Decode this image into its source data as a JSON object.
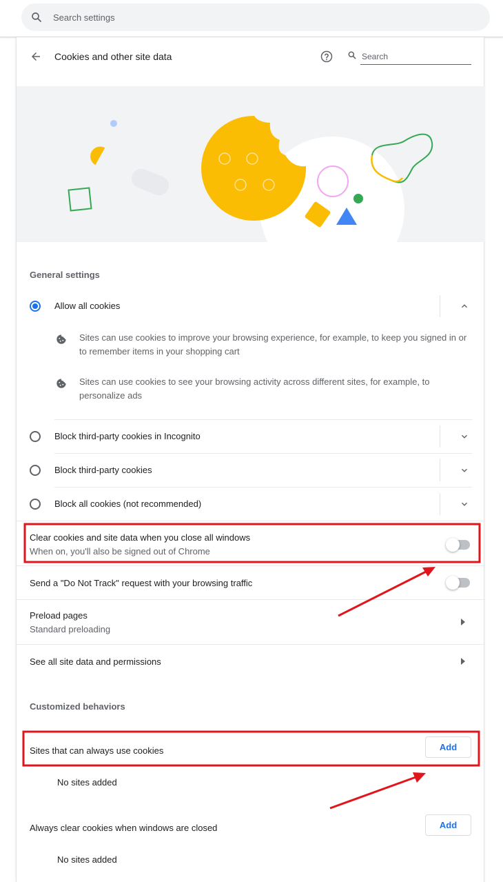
{
  "top_search": {
    "placeholder": "Search settings",
    "icon": "search-icon"
  },
  "subpage": {
    "title": "Cookies and other site data",
    "search_placeholder": "Search",
    "icons": [
      "back-arrow-icon",
      "help-icon",
      "search-icon"
    ]
  },
  "general": {
    "title": "General settings",
    "options": [
      {
        "label": "Allow all cookies",
        "checked": true,
        "expanded": true
      },
      {
        "label": "Block third-party cookies in Incognito",
        "checked": false,
        "expanded": false
      },
      {
        "label": "Block third-party cookies",
        "checked": false,
        "expanded": false
      },
      {
        "label": "Block all cookies (not recommended)",
        "checked": false,
        "expanded": false
      }
    ],
    "bullets": [
      "Sites can use cookies to improve your browsing experience, for example, to keep you signed in or to remember items in your shopping cart",
      "Sites can use cookies to see your browsing activity across different sites, for example, to personalize ads"
    ]
  },
  "settings": {
    "clear_on_close": {
      "label": "Clear cookies and site data when you close all windows",
      "sublabel": "When on, you'll also be signed out of Chrome",
      "on": false
    },
    "do_not_track": {
      "label": "Send a \"Do Not Track\" request with your browsing traffic",
      "on": false
    },
    "preload": {
      "label": "Preload pages",
      "sublabel": "Standard preloading"
    },
    "see_all": {
      "label": "See all site data and permissions"
    }
  },
  "customized": {
    "title": "Customized behaviors",
    "always_allow": {
      "label": "Sites that can always use cookies",
      "add_label": "Add",
      "empty": "No sites added"
    },
    "always_clear": {
      "label": "Always clear cookies when windows are closed",
      "add_label": "Add",
      "empty": "No sites added"
    }
  },
  "colors": {
    "accent": "#1a73e8",
    "annotation": "#e0161c",
    "cookie": "#fbbc04",
    "green": "#34a853",
    "blue": "#4285f4",
    "pink": "#f4a6f0"
  }
}
